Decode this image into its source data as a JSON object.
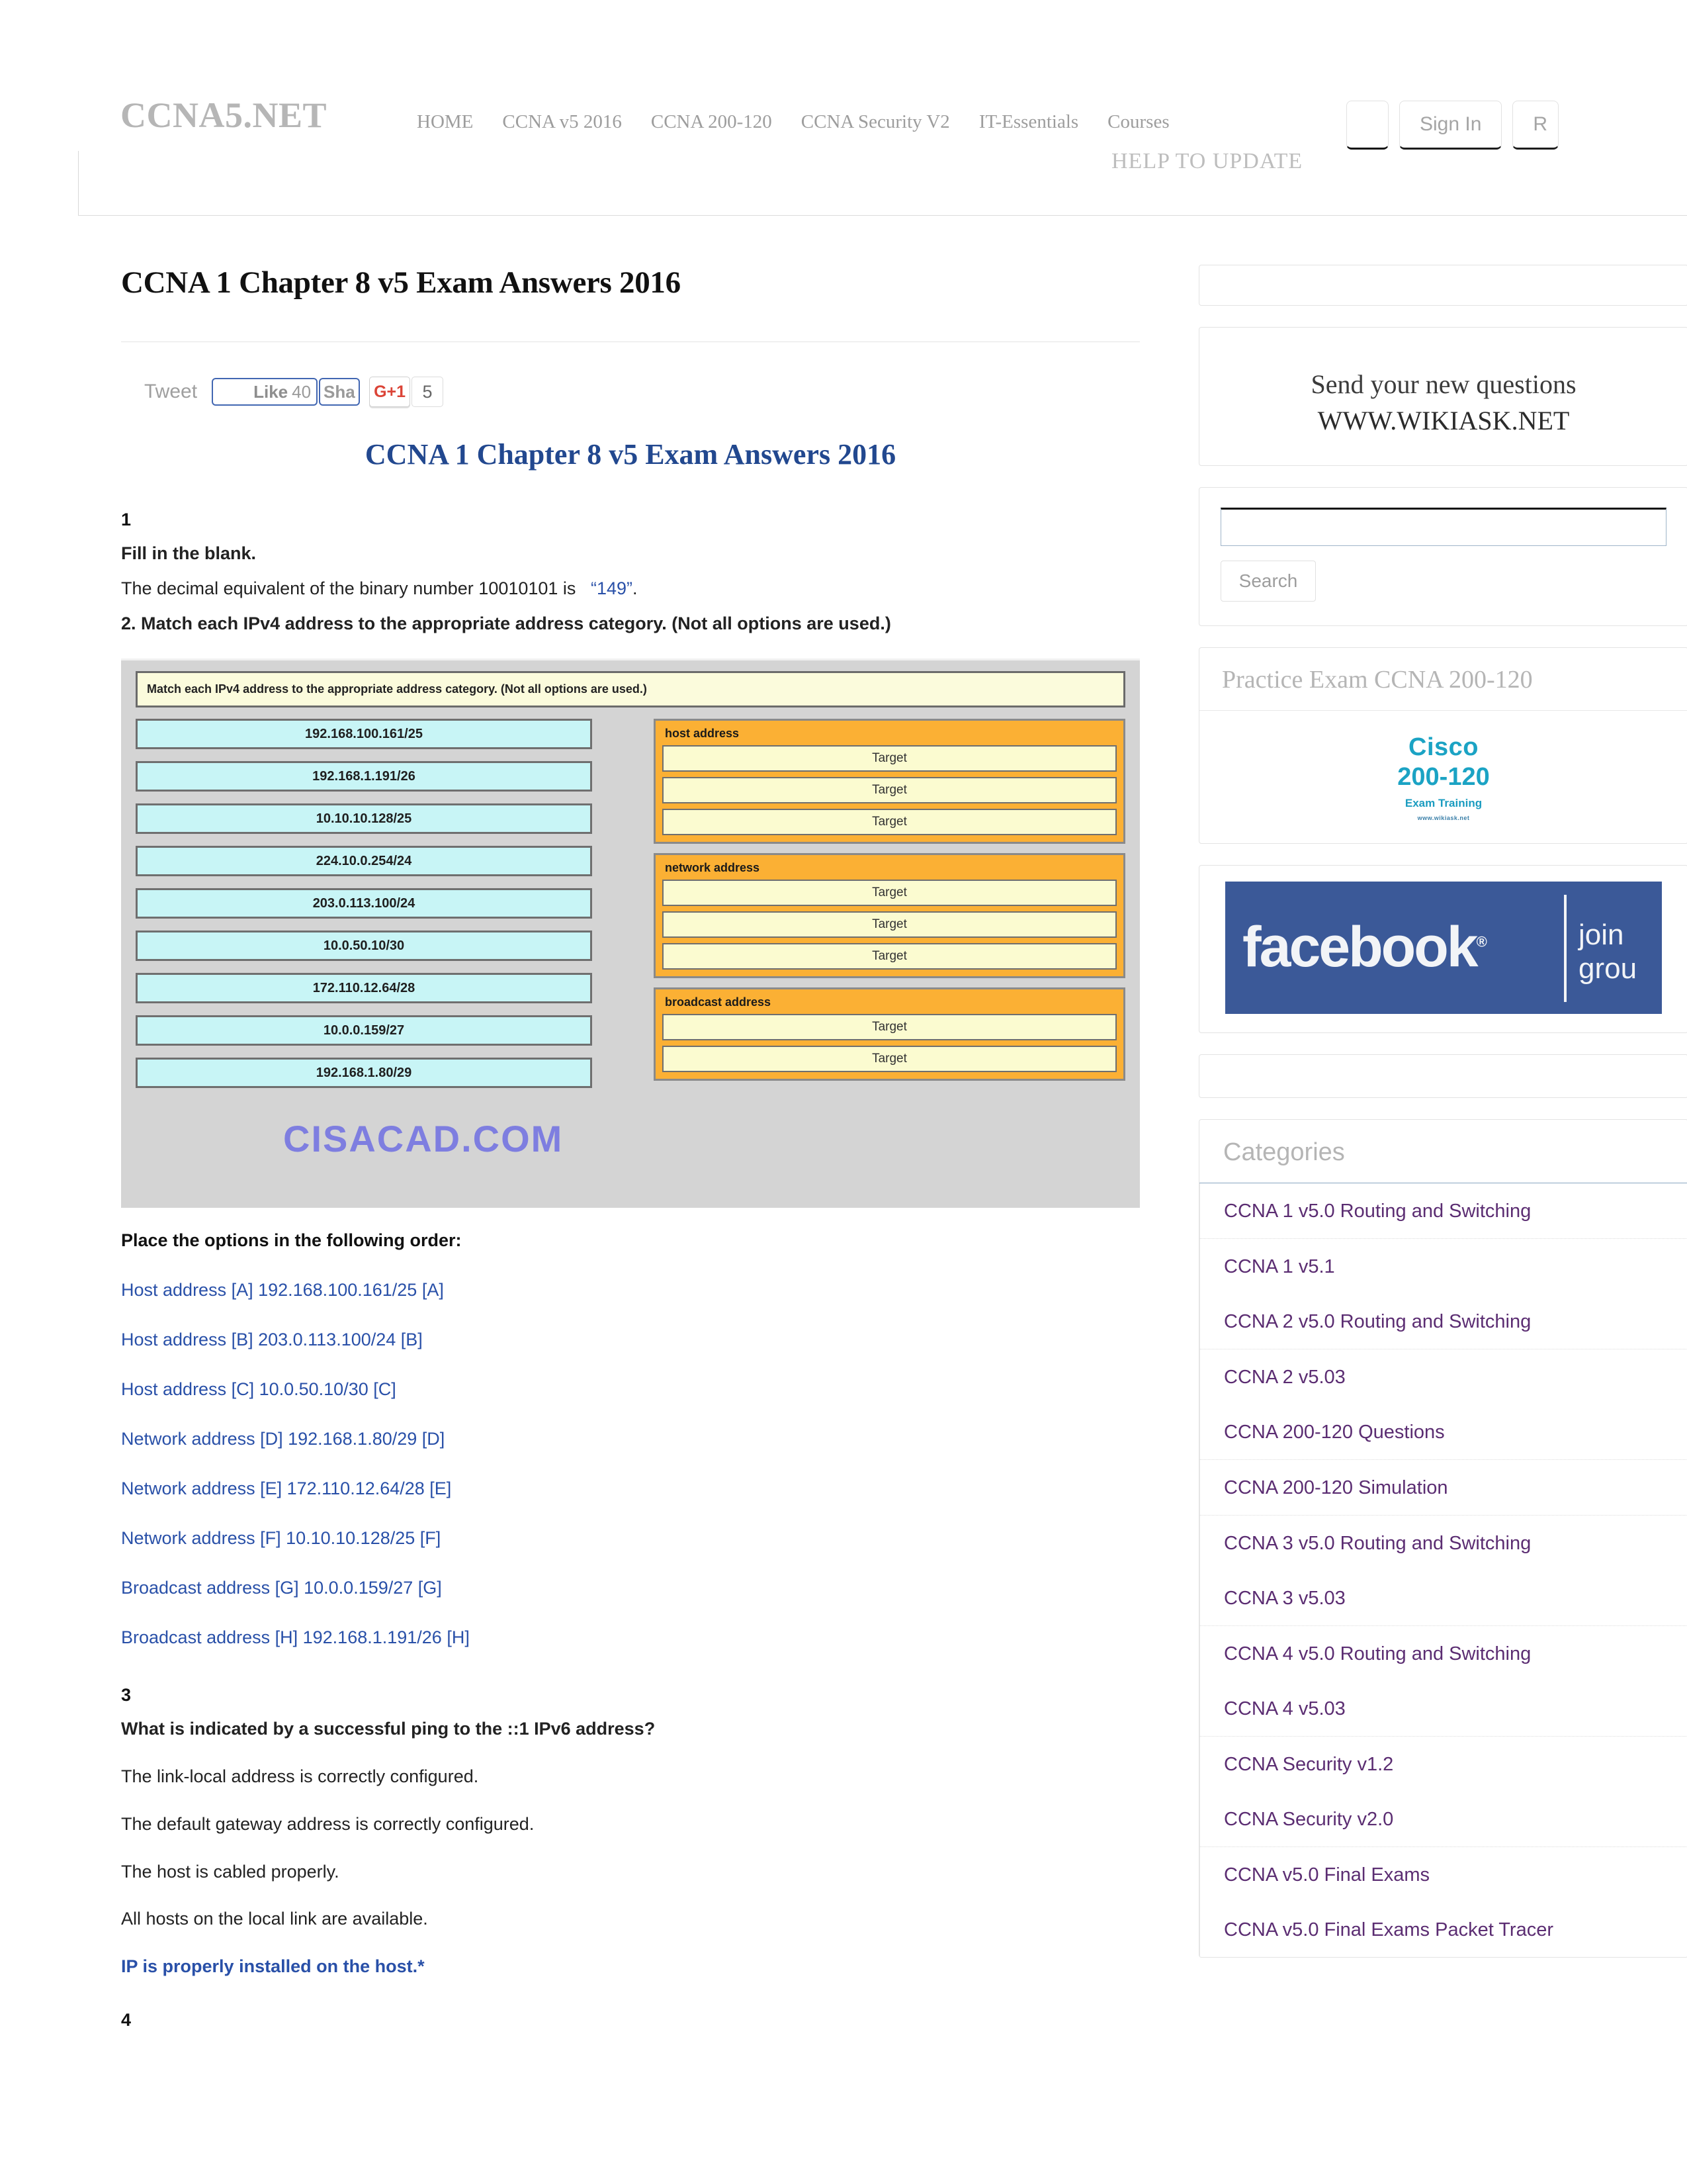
{
  "nav": {
    "brand": "CCNA5.NET",
    "links": [
      "HOME",
      "CCNA v5 2016",
      "CCNA 200-120",
      "CCNA Security V2",
      "IT-Essentials",
      "Courses"
    ],
    "blank_button": "",
    "sign_in": "Sign In",
    "register_clipped": "R",
    "help_update": "HELP TO UPDATE"
  },
  "main": {
    "post_title": "CCNA 1 Chapter 8 v5 Exam Answers 2016",
    "social": {
      "tweet": "Tweet",
      "like_label": "Like",
      "like_count": "40",
      "share_label": "Sha",
      "gplus_label": "G+1",
      "gplus_count": "5"
    },
    "post_heading": "CCNA 1 Chapter 8 v5 Exam Answers 2016",
    "q1": {
      "number": "1",
      "line1": "Fill in the blank.",
      "line2_pre": "The decimal equivalent of the binary number 10010101 is",
      "line2_answer": "“149”",
      "line2_post": ".",
      "line3": "2. Match each IPv4 address to the appropriate address category. (Not all options are used.)"
    },
    "exam_image": {
      "banner": "Match each IPv4 address to the appropriate address category. (Not all options are used.)",
      "addresses": [
        "192.168.100.161/25",
        "192.168.1.191/26",
        "10.10.10.128/25",
        "224.10.0.254/24",
        "203.0.113.100/24",
        "10.0.50.10/30",
        "172.110.12.64/28",
        "10.0.0.159/27",
        "192.168.1.80/29"
      ],
      "categories": [
        {
          "label": "host address",
          "targets": [
            "Target",
            "Target",
            "Target"
          ]
        },
        {
          "label": "network address",
          "targets": [
            "Target",
            "Target",
            "Target"
          ]
        },
        {
          "label": "broadcast address",
          "targets": [
            "Target",
            "Target"
          ]
        }
      ],
      "watermark": "CISACAD.COM"
    },
    "place_order": "Place the options in the following order:",
    "answers": [
      "Host address [A] 192.168.100.161/25 [A]",
      "Host address [B] 203.0.113.100/24 [B]",
      "Host address [C] 10.0.50.10/30 [C]",
      "Network address [D] 192.168.1.80/29 [D]",
      "Network address [E] 172.110.12.64/28 [E]",
      "Network address [F] 10.10.10.128/25 [F]",
      "Broadcast address [G] 10.0.0.159/27 [G]",
      "Broadcast address [H] 192.168.1.191/26 [H]"
    ],
    "q3": {
      "number": "3",
      "question": "What is indicated by a successful ping to the ::1 IPv6 address?",
      "options": [
        "The link-local address is correctly configured.",
        "The default gateway address is correctly configured.",
        "The host is cabled properly.",
        "All hosts on the local link are available."
      ],
      "correct": "IP is properly installed on the host.*"
    },
    "q4": {
      "number": "4"
    }
  },
  "sidebar": {
    "wikiask": {
      "line1": "Send your new questions",
      "line2": "WWW.WIKIASK.NET"
    },
    "search": {
      "value": "",
      "placeholder": "",
      "button": "Search"
    },
    "practice": {
      "title": "Practice Exam CCNA 200-120",
      "ad": {
        "line1": "Cisco",
        "line2": "200-120",
        "line3": "Exam Training",
        "line4": "www.wikiask.net"
      }
    },
    "facebook": {
      "logo": "facebook",
      "reg": "®",
      "join_line1": "join",
      "join_line2": "grou"
    },
    "categories": {
      "title": "Categories",
      "items": [
        "CCNA 1 v5.0 Routing and Switching",
        "CCNA 1 v5.1",
        "CCNA 2 v5.0 Routing and Switching",
        "CCNA 2 v5.03",
        "CCNA 200-120 Questions",
        "CCNA 200-120 Simulation",
        "CCNA 3 v5.0 Routing and Switching",
        "CCNA 3 v5.03",
        "CCNA 4 v5.0 Routing and Switching",
        "CCNA 4 v5.03",
        "CCNA Security v1.2",
        "CCNA Security v2.0",
        "CCNA v5.0 Final Exams",
        "CCNA v5.0 Final Exams Packet Tracer"
      ]
    }
  },
  "colors": {
    "link_blue": "#2950a8",
    "category_purple": "#5b2d72",
    "facebook_blue": "#3b5998",
    "cisco_teal": "#1ba3c4",
    "target_orange": "#fbb034",
    "address_cyan": "#c8f5f6"
  }
}
